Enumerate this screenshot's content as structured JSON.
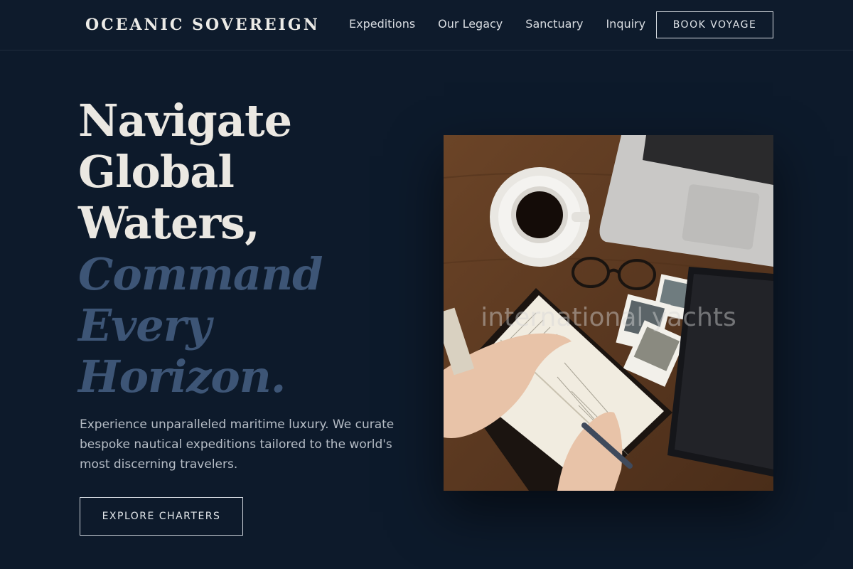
{
  "brand": {
    "name": "OCEANIC SOVEREIGN"
  },
  "nav": {
    "links": [
      "Expeditions",
      "Our Legacy",
      "Sanctuary",
      "Inquiry"
    ],
    "cta_label": "BOOK VOYAGE"
  },
  "hero": {
    "title_lines": [
      "Navigate",
      "Global",
      "Waters,"
    ],
    "accent_lines": [
      "Command",
      "Every",
      "Horizon."
    ],
    "description": "Experience unparalleled maritime luxury. We curate bespoke nautical expeditions tailored to the world's most discerning travelers.",
    "cta_label": "EXPLORE CHARTERS"
  },
  "image": {
    "caption": "international yachts",
    "subject": "desk-flatlay-photo"
  },
  "colors": {
    "background": "#0d1a2b",
    "accent_text": "#3d5576",
    "headline": "#ebe8e2"
  }
}
